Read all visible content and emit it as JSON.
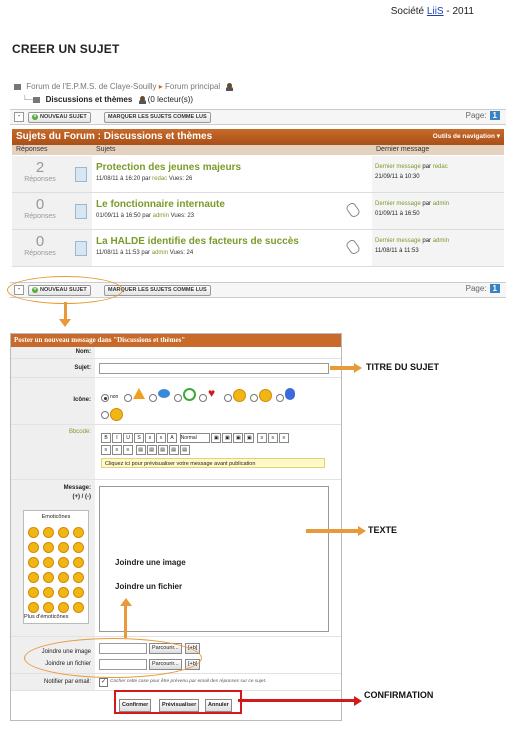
{
  "header": {
    "prefix": "Société",
    "link": "LiiS",
    "suffix": "- 2011"
  },
  "doc_title": "CREER UN SUJET",
  "forum": {
    "breadcrumb_1": "Forum de l'E.P.M.S. de Claye-Souilly",
    "breadcrumb_sep": "▸",
    "breadcrumb_2": "Forum principal",
    "sub_title": "Discussions et thèmes",
    "readers": "(0 lecteur(s))",
    "btn_new": "NOUVEAU SUJET",
    "btn_mark": "MARQUER LES SUJETS COMME LUS",
    "page_label": "Page:",
    "page_num": "1",
    "heading": "Sujets du Forum : Discussions et thèmes",
    "nav_tools": "Outils de navigation",
    "col_replies": "Réponses",
    "col_subjects": "Sujets",
    "col_last": "Dernier message",
    "topics": [
      {
        "replies": "2",
        "replies_label": "Réponses",
        "title": "Protection des jeunes majeurs",
        "date": "11/08/11 à 16:20 par",
        "author": "redac",
        "views": "Vues: 26",
        "last_label": "Dernier message",
        "last_by": "par",
        "last_author": "redac",
        "last_date": "21/09/11 à 10:30"
      },
      {
        "replies": "0",
        "replies_label": "Réponses",
        "title": "Le fonctionnaire internaute",
        "date": "01/09/11 à 16:50 par",
        "author": "admin",
        "views": "Vues: 23",
        "last_label": "Dernier message",
        "last_by": "par",
        "last_author": "admin",
        "last_date": "01/09/11 à 16:50"
      },
      {
        "replies": "0",
        "replies_label": "Réponses",
        "title": "La HALDE identifie des facteurs de succès",
        "date": "11/08/11 à 11:53 par",
        "author": "admin",
        "views": "Vues: 24",
        "last_label": "Dernier message",
        "last_by": "par",
        "last_author": "admin",
        "last_date": "11/08/11 à 11:53"
      }
    ]
  },
  "form": {
    "heading": "Poster un nouveau message dans \"Discussions et thèmes\"",
    "name_label": "Nom:",
    "subject_label": "Sujet:",
    "icon_label": "Icône:",
    "icon_none": "non",
    "bbcode_label": "Bbcode:",
    "font_select": "Normal",
    "preview_hint": "Cliquez ici pour prévisualiser votre message avant publication",
    "message_label": "Message:",
    "message_sizes": "(+) / (-)",
    "emoticons_title": "Emoticônes",
    "more_emoticons": "Plus d'émoticônes",
    "attach_image_text": "Joindre une image",
    "attach_file_text": "Joindre un fichier",
    "attach_image_label": "Joindre une image",
    "attach_file_label": "Joindre un fichier",
    "browse": "Parcourir...",
    "btn_small_1": "[+b]",
    "btn_small_2": "[+b]",
    "notify_label": "Notifier par email:",
    "notify_text": "Cocher cette case pour être prévenu par email des réponses sur ce sujet.",
    "btn_confirm": "Confirmer",
    "btn_preview": "Prévisualiser",
    "btn_cancel": "Annuler"
  },
  "annotations": {
    "title": "TITRE DU SUJET",
    "text": "TEXTE",
    "confirm": "CONFIRMATION"
  },
  "colors": {
    "accent": "#c86a2a",
    "annotation": "#e89a3a",
    "confirm_box": "#d21a1a",
    "link": "#7a9b2a"
  }
}
